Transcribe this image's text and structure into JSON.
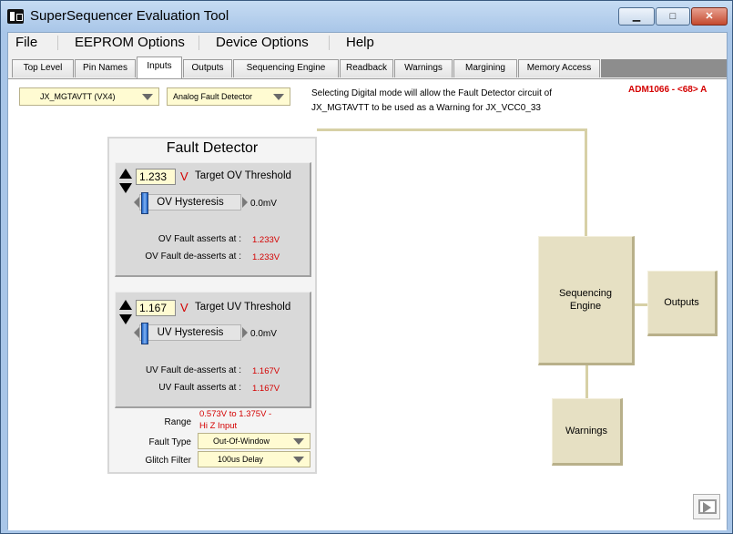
{
  "window": {
    "title": "SuperSequencer Evaluation Tool",
    "minimize_glyph": "▁",
    "maximize_glyph": "□",
    "close_glyph": "✕"
  },
  "menu": [
    "File",
    "EEPROM Options",
    "Device Options",
    "Help"
  ],
  "tabs": [
    "Top Level",
    "Pin Names",
    "Inputs",
    "Outputs",
    "Sequencing Engine",
    "Readback",
    "Warnings",
    "Margining",
    "Memory Access"
  ],
  "active_tab": "Inputs",
  "controls": {
    "input_select": "JX_MGTAVTT (VX4)",
    "mode_select": "Analog Fault Detector",
    "info_line1": "Selecting Digital mode will allow the Fault Detector circuit of",
    "info_line2": "JX_MGTAVTT to be used as a Warning for JX_VCC0_33",
    "device_id": "ADM1066 - <68> A"
  },
  "fault_detector": {
    "title": "Fault Detector",
    "ov": {
      "threshold_value": "1.233",
      "unit": "V",
      "threshold_label": "Target OV Threshold",
      "hysteresis_label": "OV Hysteresis",
      "hysteresis_value": "0.0mV",
      "assert_label": "OV Fault asserts at :",
      "assert_value": "1.233V",
      "deassert_label": "OV Fault de-asserts at :",
      "deassert_value": "1.233V"
    },
    "uv": {
      "threshold_value": "1.167",
      "unit": "V",
      "threshold_label": "Target UV Threshold",
      "hysteresis_label": "UV Hysteresis",
      "hysteresis_value": "0.0mV",
      "deassert_label": "UV Fault de-asserts at :",
      "deassert_value": "1.167V",
      "assert_label": "UV Fault asserts at :",
      "assert_value": "1.167V"
    },
    "range_label": "Range",
    "range_value_1": "0.573V to 1.375V -",
    "range_value_2": "Hi Z Input",
    "fault_type_label": "Fault Type",
    "fault_type_value": "Out-Of-Window",
    "glitch_filter_label": "Glitch Filter",
    "glitch_filter_value": "100us Delay"
  },
  "blocks": {
    "seq_line1": "Sequencing",
    "seq_line2": "Engine",
    "outputs": "Outputs",
    "warnings": "Warnings"
  },
  "colors": {
    "accent_red": "#d40000",
    "block_fill": "#e6e0c3",
    "input_fill": "#fffbd2"
  }
}
